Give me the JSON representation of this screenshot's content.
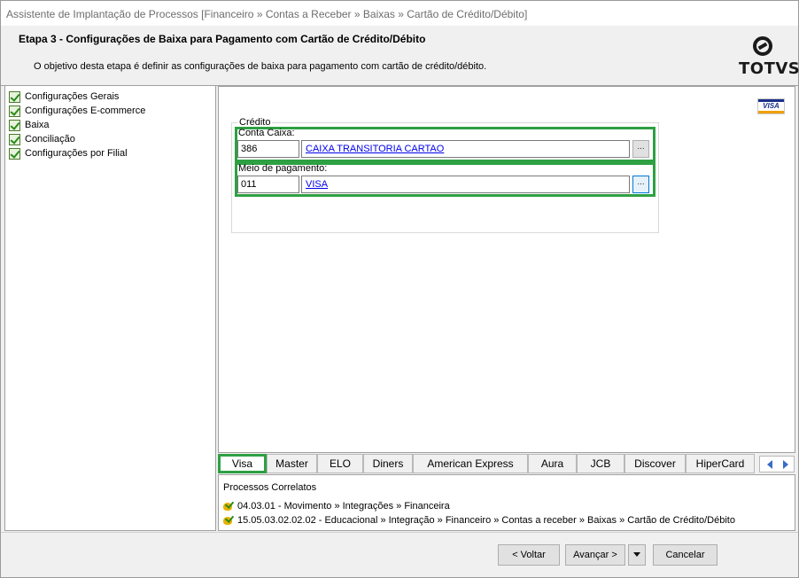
{
  "window": {
    "title": "Assistente de Implantação de Processos [Financeiro » Contas a Receber » Baixas » Cartão de Crédito/Débito]"
  },
  "header": {
    "step_title": "Etapa 3 - Configurações de Baixa para Pagamento com Cartão de Crédito/Débito",
    "description": "O objetivo desta etapa é definir as configurações de baixa para pagamento com cartão de crédito/débito.",
    "logo_text": "TOTVS"
  },
  "tree": {
    "items": [
      {
        "label": "Configurações Gerais",
        "status": "checked"
      },
      {
        "label": "Configurações E-commerce",
        "status": "checked"
      },
      {
        "label": "Baixa",
        "status": "checked"
      },
      {
        "label": "Conciliação",
        "status": "checked"
      },
      {
        "label": "Configurações por Filial",
        "status": "checked"
      }
    ]
  },
  "content": {
    "brand_icon": "visa-logo",
    "brand_text": "VISA",
    "group_title": "Crédito",
    "conta_caixa": {
      "label": "Conta Caixa:",
      "code": "386",
      "description": "CAIXA TRANSITORIA CARTAO",
      "lookup_label": "..."
    },
    "meio_pagamento": {
      "label": "Meio de pagamento:",
      "code": "011",
      "description": "VISA",
      "lookup_label": "..."
    }
  },
  "tabs": [
    {
      "label": "Visa",
      "active": true
    },
    {
      "label": "Master"
    },
    {
      "label": "ELO"
    },
    {
      "label": "Diners"
    },
    {
      "label": "American Express"
    },
    {
      "label": "Aura"
    },
    {
      "label": "JCB"
    },
    {
      "label": "Discover"
    },
    {
      "label": "HiperCard"
    }
  ],
  "processes": {
    "title": "Processos Correlatos",
    "items": [
      {
        "label": "04.03.01 - Movimento » Integrações » Financeira"
      },
      {
        "label": "15.05.03.02.02.02 - Educacional » Integração » Financeiro » Contas a receber » Baixas » Cartão de Crédito/Débito"
      }
    ]
  },
  "footer": {
    "back_label": "< Voltar",
    "next_label": "Avançar >",
    "cancel_label": "Cancelar"
  },
  "colors": {
    "highlight": "#2ea043",
    "link": "#0000ee",
    "visa_blue": "#1a2f8a",
    "visa_gold": "#f0a000"
  }
}
